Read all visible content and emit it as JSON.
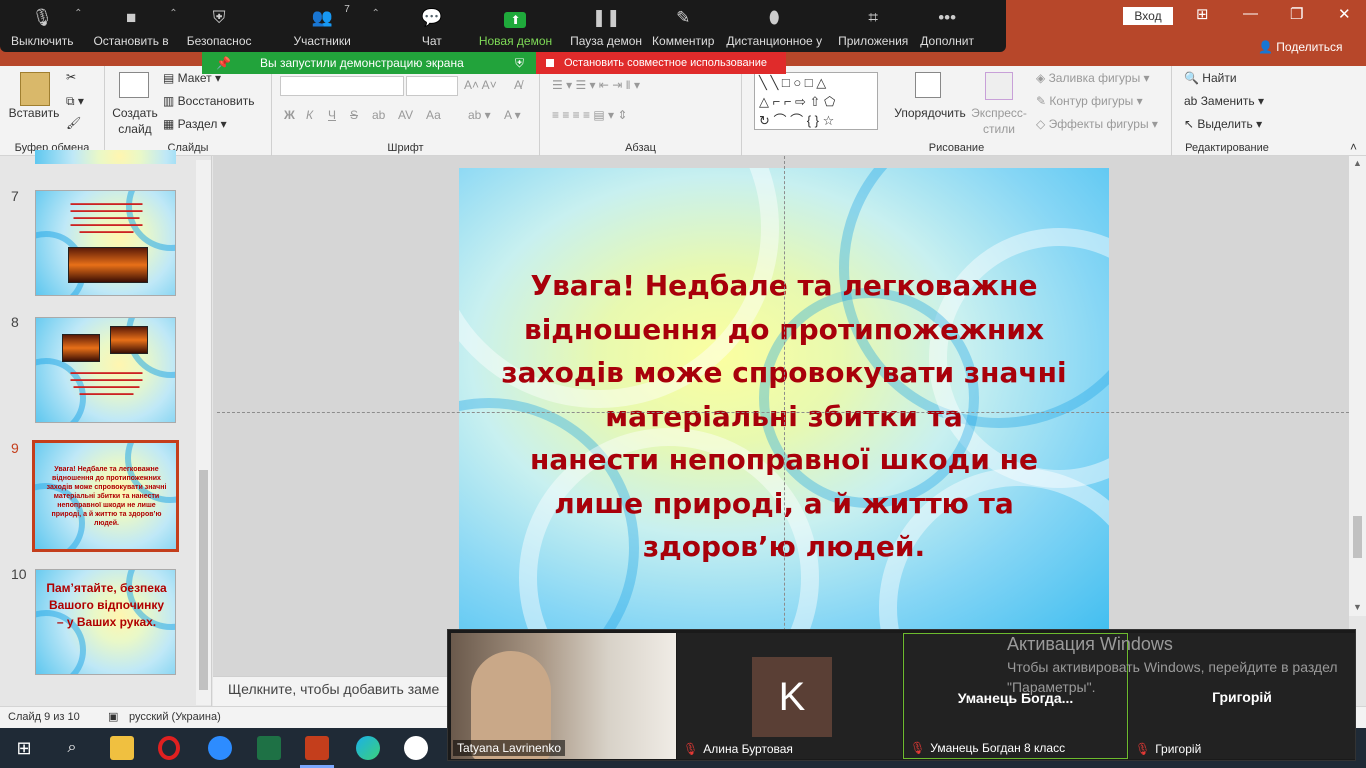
{
  "zoom": {
    "buttons": [
      {
        "label": "Выключить",
        "icon": "microphone-icon"
      },
      {
        "label": "Остановить в",
        "icon": "video-camera-icon"
      },
      {
        "label": "Безопаснос",
        "icon": "shield-icon"
      },
      {
        "label": "Участники",
        "icon": "participants-icon",
        "count": "7"
      },
      {
        "label": "Чат",
        "icon": "chat-icon"
      },
      {
        "label": "Новая демон",
        "icon": "share-screen-icon"
      },
      {
        "label": "Пауза демон",
        "icon": "pause-icon"
      },
      {
        "label": "Комментир",
        "icon": "pencil-icon"
      },
      {
        "label": "Дистанционное у",
        "icon": "mouse-icon"
      },
      {
        "label": "Приложения",
        "icon": "apps-icon"
      },
      {
        "label": "Дополнит",
        "icon": "more-icon"
      }
    ],
    "share_banner": "Вы запустили демонстрацию экрана",
    "stop_banner": "Остановить совместное использование"
  },
  "window": {
    "signin": "Вход",
    "share": "Поделиться"
  },
  "ribbon": {
    "groups": {
      "clipboard": "Буфер обмена",
      "slides": "Слайды",
      "font": "Шрифт",
      "paragraph": "Абзац",
      "drawing": "Рисование",
      "editing": "Редактирование"
    },
    "paste": "Вставить",
    "new_slide_1": "Создать",
    "new_slide_2": "слайд",
    "layout": "Макет",
    "reset": "Восстановить",
    "section": "Раздел",
    "bold": "Ж",
    "italic": "К",
    "underline": "Ч",
    "strike": "S",
    "font_size_a": "Аа",
    "arrange": "Упорядочить",
    "quick_styles_1": "Экспресс-",
    "quick_styles_2": "стили",
    "shape_fill": "Заливка фигуры",
    "shape_outline": "Контур фигуры",
    "shape_effects": "Эффекты фигуры",
    "find": "Найти",
    "replace": "Заменить",
    "select": "Выделить"
  },
  "slides": [
    {
      "number": "7"
    },
    {
      "number": "8"
    },
    {
      "number": "9"
    },
    {
      "number": "10",
      "text": "Пам’ятайте, безпека Вашого відпочинку – у Ваших руках."
    }
  ],
  "slide9_thumb_text": "Увага! Недбале та легковажне відношення до протипожежних заходів може спровокувати значні матеріальні збитки та нанести непоправної шкоди не лише природі, а й життю та здоров’ю людей.",
  "main_slide": {
    "lines": [
      "Увага! Недбале та легковажне",
      "відношення до протипожежних",
      "заходів може спровокувати значні",
      "матеріальні збитки та",
      "нанести непоправної шкоди не",
      "лише природі, а й життю та",
      "здоров’ю людей."
    ]
  },
  "notes_placeholder": "Щелкните, чтобы добавить заме",
  "status": {
    "slide": "Слайд 9 из 10",
    "language": "русский (Украина)"
  },
  "gallery": {
    "tiles": [
      {
        "name": "Tatyana Lavrinenko"
      },
      {
        "name": "Алина Буртовая",
        "avatar": "K"
      },
      {
        "name": "Уманець Богдан 8 класс",
        "big": "Уманець  Богда..."
      },
      {
        "name": "Григорій",
        "big": "Григорій"
      }
    ]
  },
  "watermark": {
    "title": "Активация Windows",
    "text": "Чтобы активировать Windows, перейдите в раздел \"Параметры\"."
  },
  "colors": {
    "accent": "#b7472a",
    "slide_text": "#a8000a",
    "share_green": "#22a33b",
    "stop_red": "#e02b2b"
  }
}
